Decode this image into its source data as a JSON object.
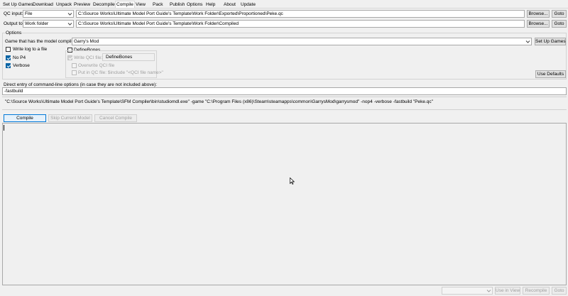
{
  "menu": {
    "items": [
      "Set Up Games",
      "Download",
      "Unpack",
      "Preview",
      "Decompile",
      "Compile",
      "View",
      "Pack",
      "Publish",
      "Options",
      "Help",
      "About",
      "Update"
    ],
    "active": "Compile"
  },
  "qc_input": {
    "label": "QC input:",
    "mode": "File",
    "path": "C:\\Source Works\\Ultimate Model Port Guide's Template\\Work Folder\\Exported\\Proportioned\\Peke.qc",
    "browse_label": "Browse...",
    "goto_label": "Goto"
  },
  "output_to": {
    "label": "Output to:",
    "mode": "Work folder",
    "path": "C:\\Source Works\\Ultimate Model Port Guide's Template\\Work Folder\\Compiled",
    "browse_label": "Browse...",
    "goto_label": "Goto"
  },
  "options": {
    "group_label": "Options",
    "game_label": "Game that has the model compiler:",
    "game_value": "Garry's Mod",
    "setup_games_label": "Set Up Games",
    "write_log_label": "Write log to a file",
    "no_p4_label": "No P4",
    "verbose_label": "Verbose",
    "define_bones_label": "DefineBones",
    "write_qci_label": "Write QCI file:",
    "qci_name_value": "DefineBones",
    "overwrite_qci_label": "Overwrite QCI file",
    "put_in_qc_label": "Put in QC file: $include \"<QCI file name>\"",
    "use_defaults_label": "Use Defaults",
    "checks": {
      "write_log": false,
      "no_p4": true,
      "verbose": true,
      "define_bones": false,
      "write_qci": true,
      "overwrite_qci": false,
      "put_in_qc": false
    }
  },
  "direct_entry": {
    "label": "Direct entry of command-line options (in case they are not included above):",
    "value": "-fastbuild"
  },
  "command_line": "\"C:\\Source Works\\Ultimate Model Port Guide's Template\\SFM Compiler\\bin\\studiomdl.exe\" -game \"C:\\Program Files (x86)\\Steam\\steamapps\\common\\GarrysMod\\garrysmod\" -nop4 -verbose -fastbuild \"Peke.qc\"",
  "actions": {
    "compile_label": "Compile",
    "skip_label": "Skip Current Model",
    "cancel_label": "Cancel Compile"
  },
  "bottom": {
    "use_in_view_label": "Use in View",
    "recompile_label": "Recompile",
    "goto_label": "Goto"
  }
}
